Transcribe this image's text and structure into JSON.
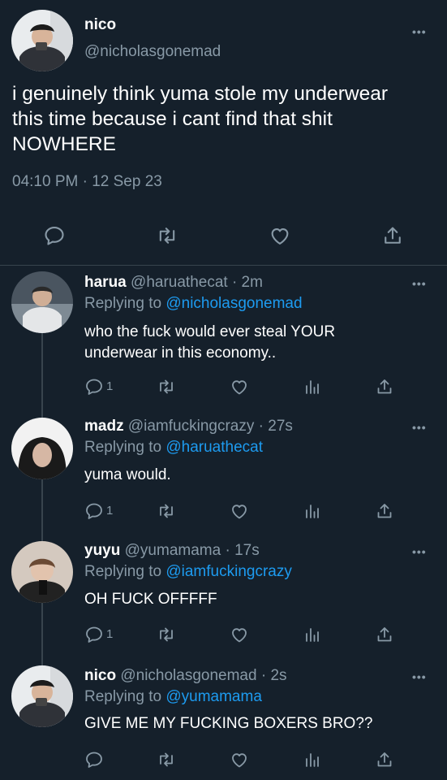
{
  "colors": {
    "background": "#15202b",
    "muted": "#8899a6",
    "link": "#1d9bf0",
    "divider": "#38444d"
  },
  "main_tweet": {
    "display_name": "nico",
    "handle": "@nicholasgonemad",
    "text_line1": "i genuinely think yuma stole my underwear",
    "text_line2": "this time because i cant find that shit",
    "text_line3": "NOWHERE",
    "timestamp": "04:10 PM · 12 Sep 23",
    "actions": [
      "reply-icon",
      "retweet-icon",
      "like-icon",
      "share-icon"
    ]
  },
  "replies": [
    {
      "display_name": "harua",
      "handle": "@haruathecat",
      "time": "· 2m",
      "replying_label": "Replying to",
      "replying_to": "@nicholasgonemad",
      "text_line1": "who the fuck would ever steal YOUR",
      "text_line2": "underwear in this economy..",
      "reply_count": "1"
    },
    {
      "display_name": "madz",
      "handle": "@iamfuckingcrazy",
      "time": "· 27s",
      "replying_label": "Replying to",
      "replying_to": "@haruathecat",
      "text_line1": "yuma would.",
      "reply_count": "1"
    },
    {
      "display_name": "yuyu",
      "handle": "@yumamama",
      "time": "· 17s",
      "replying_label": "Replying to",
      "replying_to": "@iamfuckingcrazy",
      "text_line1": "OH FUCK OFFFFF",
      "reply_count": "1"
    },
    {
      "display_name": "nico",
      "handle": "@nicholasgonemad",
      "time": "· 2s",
      "replying_label": "Replying to",
      "replying_to": "@yumamama",
      "text_line1": "GIVE ME MY FUCKING BOXERS BRO??",
      "reply_count": ""
    }
  ],
  "more_label": "•••"
}
